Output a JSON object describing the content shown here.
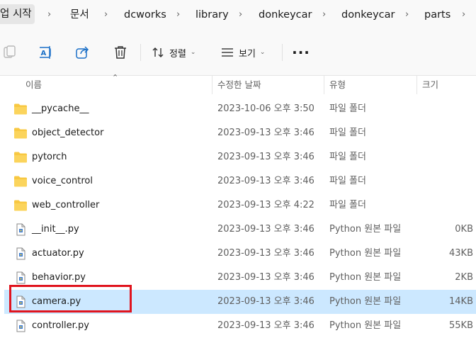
{
  "breadcrumb": {
    "items": [
      "업 시작",
      "문서",
      "dcworks",
      "library",
      "donkeycar",
      "donkeycar",
      "parts"
    ],
    "separator": "›"
  },
  "toolbar": {
    "sort_label": "정렬",
    "view_label": "보기",
    "more_label": "···",
    "icons": [
      "copy-icon",
      "rename-icon",
      "share-icon",
      "delete-icon",
      "sort-icon",
      "view-icon",
      "more-icon"
    ]
  },
  "columns": {
    "name": "이름",
    "modified": "수정한 날짜",
    "type": "유형",
    "size": "크기"
  },
  "files": [
    {
      "name": "__pycache__",
      "modified": "2023-10-06 오후 3:50",
      "type": "파일 폴더",
      "size": "",
      "kind": "folder"
    },
    {
      "name": "object_detector",
      "modified": "2023-09-13 오후 3:46",
      "type": "파일 폴더",
      "size": "",
      "kind": "folder"
    },
    {
      "name": "pytorch",
      "modified": "2023-09-13 오후 3:46",
      "type": "파일 폴더",
      "size": "",
      "kind": "folder"
    },
    {
      "name": "voice_control",
      "modified": "2023-09-13 오후 3:46",
      "type": "파일 폴더",
      "size": "",
      "kind": "folder"
    },
    {
      "name": "web_controller",
      "modified": "2023-09-13 오후 4:22",
      "type": "파일 폴더",
      "size": "",
      "kind": "folder"
    },
    {
      "name": "__init__.py",
      "modified": "2023-09-13 오후 3:46",
      "type": "Python 원본 파일",
      "size": "0KB",
      "kind": "python"
    },
    {
      "name": "actuator.py",
      "modified": "2023-09-13 오후 3:46",
      "type": "Python 원본 파일",
      "size": "43KB",
      "kind": "python"
    },
    {
      "name": "behavior.py",
      "modified": "2023-09-13 오후 3:46",
      "type": "Python 원본 파일",
      "size": "2KB",
      "kind": "python"
    },
    {
      "name": "camera.py",
      "modified": "2023-09-13 오후 3:46",
      "type": "Python 원본 파일",
      "size": "14KB",
      "kind": "python",
      "selected": true
    },
    {
      "name": "controller.py",
      "modified": "2023-09-13 오후 3:46",
      "type": "Python 원본 파일",
      "size": "55KB",
      "kind": "python"
    }
  ],
  "colors": {
    "selection": "#cce8ff",
    "highlight_box": "#e0141e",
    "folder": "#f8c842",
    "accent": "#0067c0"
  }
}
